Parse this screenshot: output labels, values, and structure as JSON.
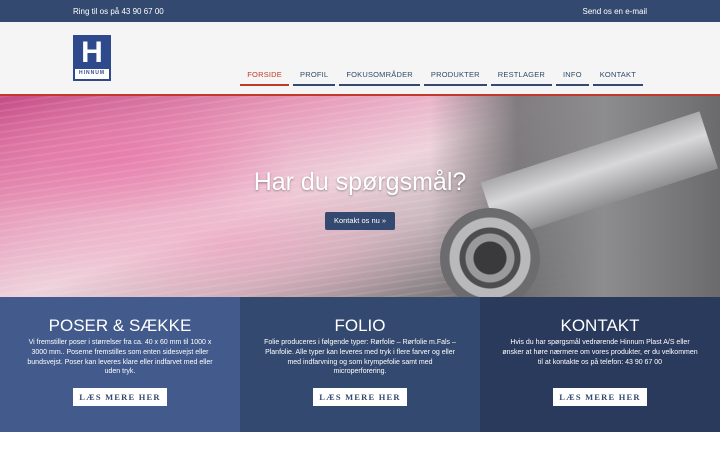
{
  "topbar": {
    "phone": "Ring til os på 43 90 67 00",
    "email": "Send os en e-mail"
  },
  "logo": {
    "letter": "H",
    "word": "HINNUM"
  },
  "nav": {
    "items": [
      {
        "label": "FORSIDE",
        "active": true
      },
      {
        "label": "PROFIL",
        "active": false
      },
      {
        "label": "FOKUSOMRÅDER",
        "active": false
      },
      {
        "label": "PRODUKTER",
        "active": false
      },
      {
        "label": "RESTLAGER",
        "active": false
      },
      {
        "label": "INFO",
        "active": false
      },
      {
        "label": "KONTAKT",
        "active": false
      }
    ]
  },
  "hero": {
    "title": "Har du spørgsmål?",
    "cta": "Kontakt os nu »"
  },
  "boxes": [
    {
      "title": "POSER & SÆKKE",
      "text": "Vi fremstiller poser i størrelser fra ca. 40 x 60 mm til 1000 x 3000 mm.. Poserne fremstilles som enten sidesvejst eller bundsvejst. Poser kan leveres klare eller indfarvet med eller uden tryk.",
      "button": "LÆS MERE HER"
    },
    {
      "title": "FOLIO",
      "text": "Folie produceres i følgende typer: Rørfolie – Rørfolie m.Fals – Planfolie. Alle typer kan leveres med tryk i flere farver og eller med indfarvning og som krympefolie samt med microperforering.",
      "button": "LÆS MERE HER"
    },
    {
      "title": "KONTAKT",
      "text": "Hvis du har spørgsmål vedrørende Hinnum Plast A/S eller ønsker at høre nærmere om vores produkter, er du velkommen til at kontakte os på telefon: 43 90 67 00",
      "button": "LÆS MERE HER"
    }
  ],
  "colors": {
    "brand_blue": "#34496f",
    "accent_red": "#c0392b",
    "box1": "#425b8c",
    "box2": "#34496f",
    "box3": "#2a3a5c"
  }
}
